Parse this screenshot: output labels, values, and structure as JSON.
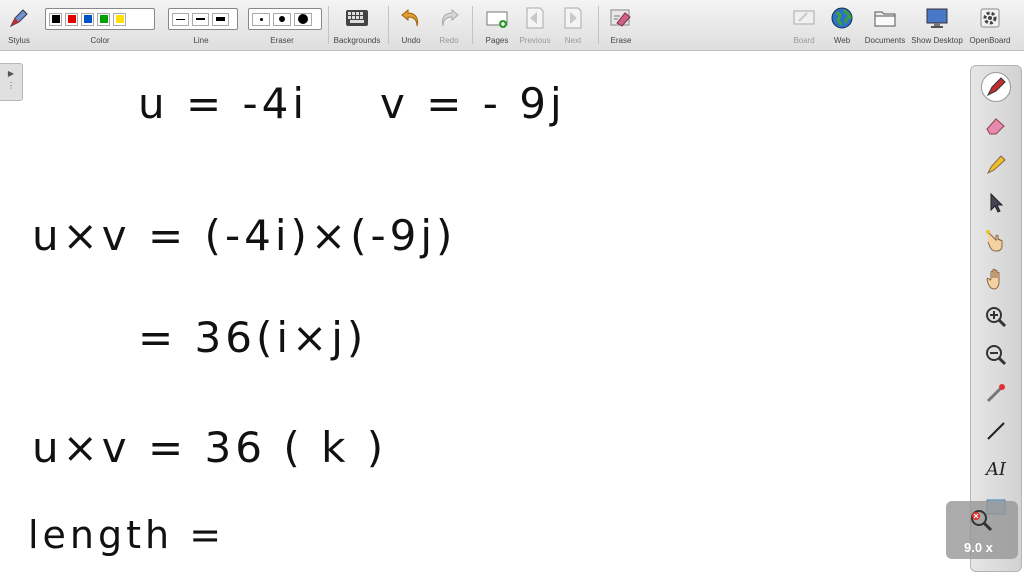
{
  "toolbar": {
    "stylus": "Stylus",
    "color": "Color",
    "line": "Line",
    "eraser": "Eraser",
    "backgrounds": "Backgrounds",
    "undo": "Undo",
    "redo": "Redo",
    "pages": "Pages",
    "previous": "Previous",
    "next": "Next",
    "erase": "Erase",
    "board": "Board",
    "web": "Web",
    "documents": "Documents",
    "show_desktop": "Show Desktop",
    "openboard": "OpenBoard"
  },
  "colors": {
    "swatches": [
      "#000000",
      "#e00000",
      "#0050c8",
      "#00a000",
      "#ffe000"
    ]
  },
  "palette": {
    "text_tool": "AI"
  },
  "zoom": {
    "label": "9.0 x"
  },
  "board": {
    "line1_u": "u =  -4i",
    "line1_v": "v = - 9j",
    "line2": "u×v = (-4i)×(-9j)",
    "line3": "= 36(i×j)",
    "line4": "u×v = 36 ( k )",
    "line5": "length ="
  }
}
